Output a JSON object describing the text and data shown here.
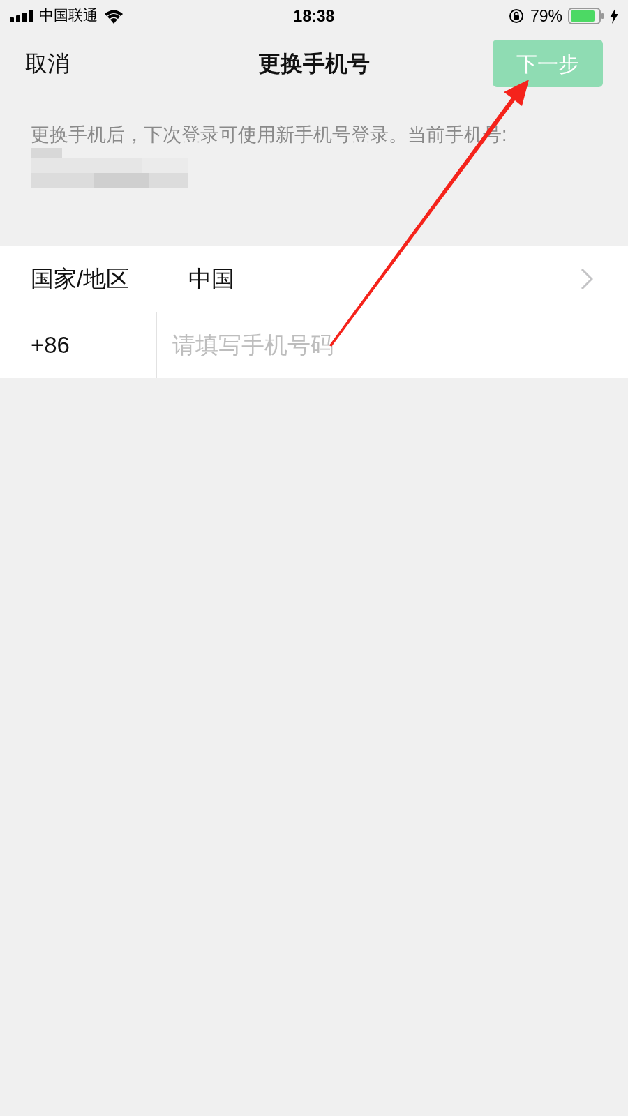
{
  "status_bar": {
    "carrier": "中国联通",
    "time": "18:38",
    "battery": "79%"
  },
  "nav": {
    "cancel": "取消",
    "title": "更换手机号",
    "next_button": {
      "label": "下一步",
      "disabled": true
    }
  },
  "description": "更换手机后，下次登录可使用新手机号登录。当前手机号:",
  "form": [
    {
      "kind": "select",
      "label": "国家/地区",
      "value": "中国"
    },
    {
      "kind": "input",
      "label": "+86",
      "placeholder": "请填写手机号码"
    }
  ]
}
